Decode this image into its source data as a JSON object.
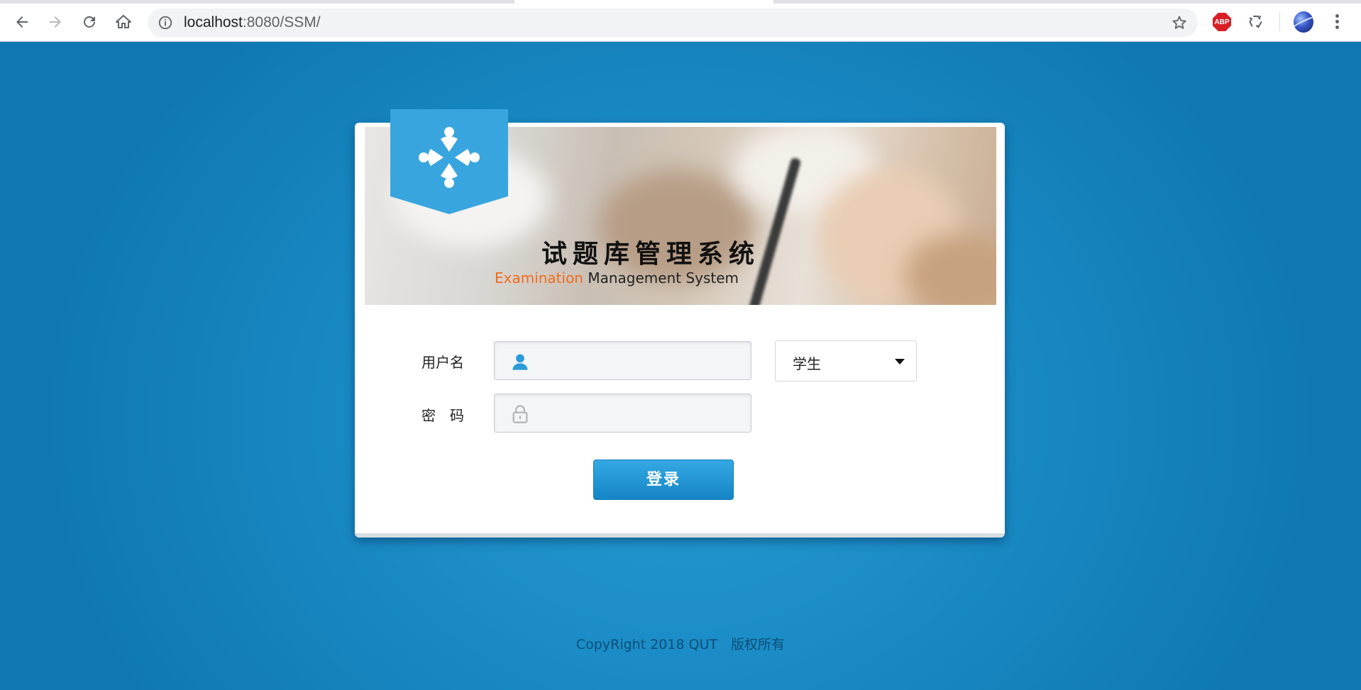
{
  "browser": {
    "url_host": "localhost",
    "url_rest": ":8080/SSM/",
    "extension_abp_label": "ABP",
    "icons": {
      "back": "arrow-left-icon",
      "forward": "arrow-right-icon",
      "reload": "reload-icon",
      "home": "home-icon",
      "site_info": "info-icon",
      "bookmark": "star-icon",
      "recycle": "recycle-icon",
      "menu": "kebab-icon"
    }
  },
  "login": {
    "banner_title": "试题库管理系统",
    "banner_subtitle_accent": "Examination",
    "banner_subtitle_rest": " Management System",
    "username_label": "用户名",
    "password_label": "密　码",
    "username_value": "",
    "password_value": "",
    "role_selected": "学生",
    "submit_label": "登录",
    "accent_color": "#39a5df",
    "subtitle_accent_color": "#f26b1d"
  },
  "footer": {
    "text": "CopyRight 2018 QUT　版权所有"
  }
}
